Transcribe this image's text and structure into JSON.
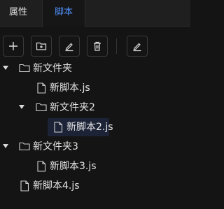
{
  "tabs": {
    "properties": "属性",
    "script": "脚本"
  },
  "toolbar": {
    "buttons": [
      {
        "name": "add-button",
        "icon": "plus-icon"
      },
      {
        "name": "new-folder-button",
        "icon": "folder-plus-icon"
      },
      {
        "name": "rename-button",
        "icon": "pencil-icon"
      },
      {
        "name": "delete-button",
        "icon": "trash-icon"
      },
      {
        "name": "edit-button",
        "icon": "pencil-icon"
      }
    ]
  },
  "tree": {
    "items": [
      {
        "label": "新文件夹",
        "type": "folder",
        "expanded": true,
        "depth": 0
      },
      {
        "label": "新脚本.js",
        "type": "file",
        "depth": 1
      },
      {
        "label": "新文件夹2",
        "type": "folder",
        "expanded": true,
        "depth": 1
      },
      {
        "label": "新脚本2.js",
        "type": "file",
        "depth": 2,
        "selected": true
      },
      {
        "label": "新文件夹3",
        "type": "folder",
        "expanded": true,
        "depth": 0
      },
      {
        "label": "新脚本3.js",
        "type": "file",
        "depth": 1
      },
      {
        "label": "新脚本4.js",
        "type": "file",
        "depth": 0
      }
    ]
  },
  "colors": {
    "accent": "#4f8ef7",
    "background": "#141414",
    "selection": "#1c2336"
  }
}
